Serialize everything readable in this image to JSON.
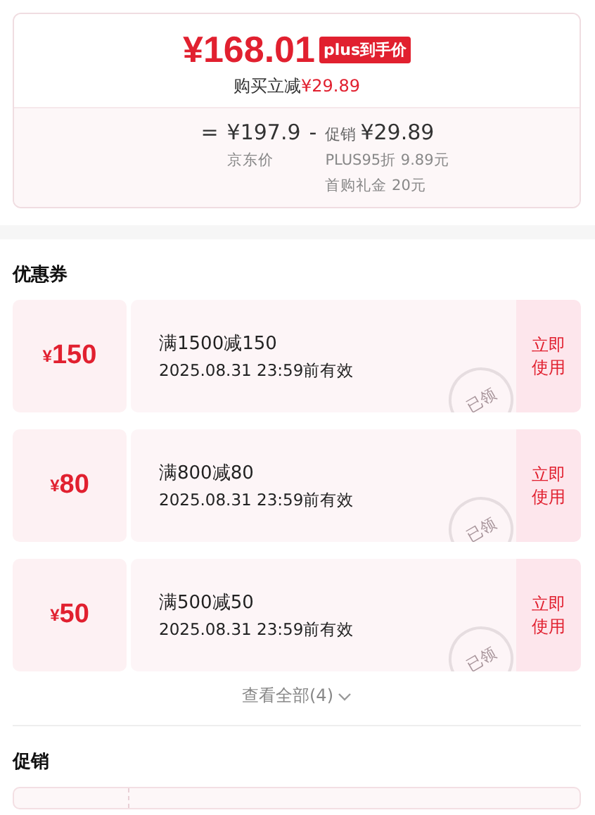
{
  "price_card": {
    "price": "¥168.01",
    "badge": "plus到手价",
    "saving_label": "购买立减",
    "saving_amount": "¥29.89",
    "breakdown": {
      "equals": "=",
      "base_price": "¥197.9",
      "base_label": "京东价",
      "minus": "-",
      "promo_label": "促销",
      "promo_amount": "¥29.89",
      "promo_details": [
        "PLUS95折 9.89元",
        "首购礼金 20元"
      ]
    }
  },
  "coupons": {
    "title": "优惠券",
    "items": [
      {
        "amount_symbol": "¥",
        "amount": "150",
        "condition": "满1500减150",
        "expiry": "2025.08.31 23:59前有效",
        "action": "立即使用",
        "stamp": "已领"
      },
      {
        "amount_symbol": "¥",
        "amount": "80",
        "condition": "满800减80",
        "expiry": "2025.08.31 23:59前有效",
        "action": "立即使用",
        "stamp": "已领"
      },
      {
        "amount_symbol": "¥",
        "amount": "50",
        "condition": "满500减50",
        "expiry": "2025.08.31 23:59前有效",
        "action": "立即使用",
        "stamp": "已领"
      }
    ],
    "view_all": "查看全部(4)"
  },
  "promotions": {
    "title": "促销"
  }
}
